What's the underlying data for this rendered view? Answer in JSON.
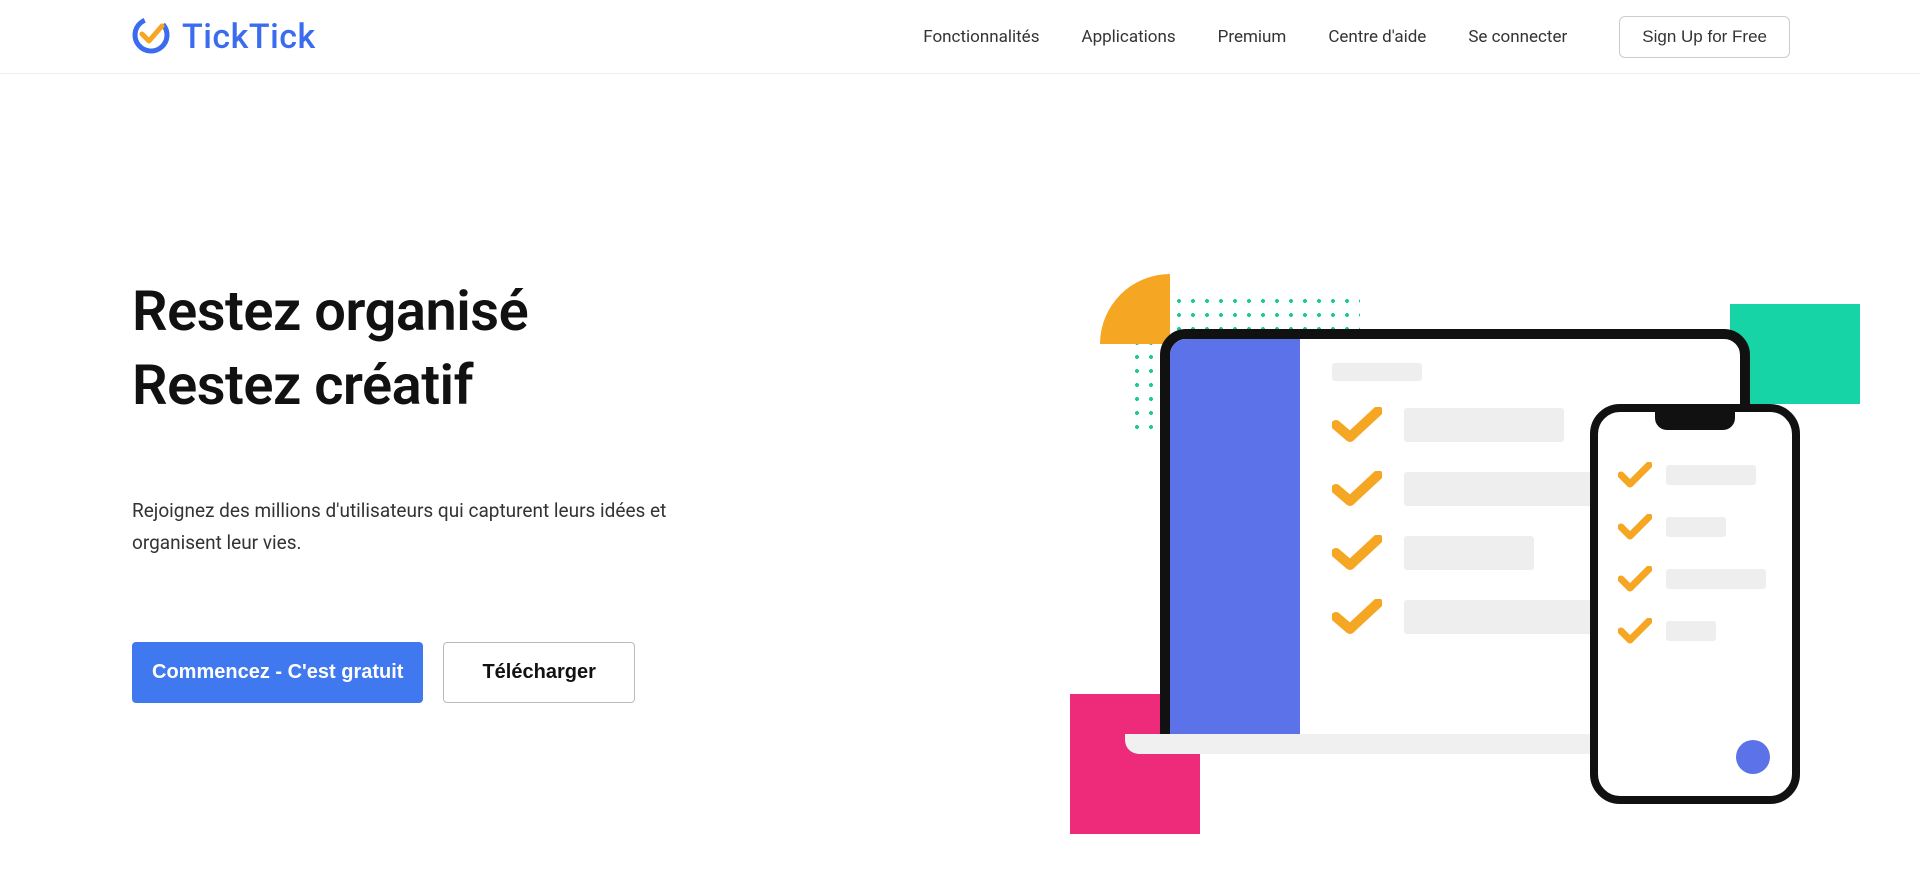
{
  "brand": {
    "name": "TickTick"
  },
  "nav": {
    "features": "Fonctionnalités",
    "apps": "Applications",
    "premium": "Premium",
    "help": "Centre d'aide",
    "signin": "Se connecter",
    "signup": "Sign Up for Free"
  },
  "hero": {
    "title_line1": "Restez organisé",
    "title_line2": "Restez créatif",
    "subtitle": "Rejoignez des millions d'utilisateurs qui capturent leurs idées et organisent leur vies.",
    "cta_primary": "Commencez - C'est gratuit",
    "cta_secondary": "Télécharger"
  },
  "colors": {
    "brand_blue": "#3b6cf0",
    "primary_button": "#4078ef",
    "accent_orange": "#f5a623",
    "accent_green": "#17d4a7",
    "accent_pink": "#ee2a7b",
    "illus_purple": "#5b72e8"
  }
}
